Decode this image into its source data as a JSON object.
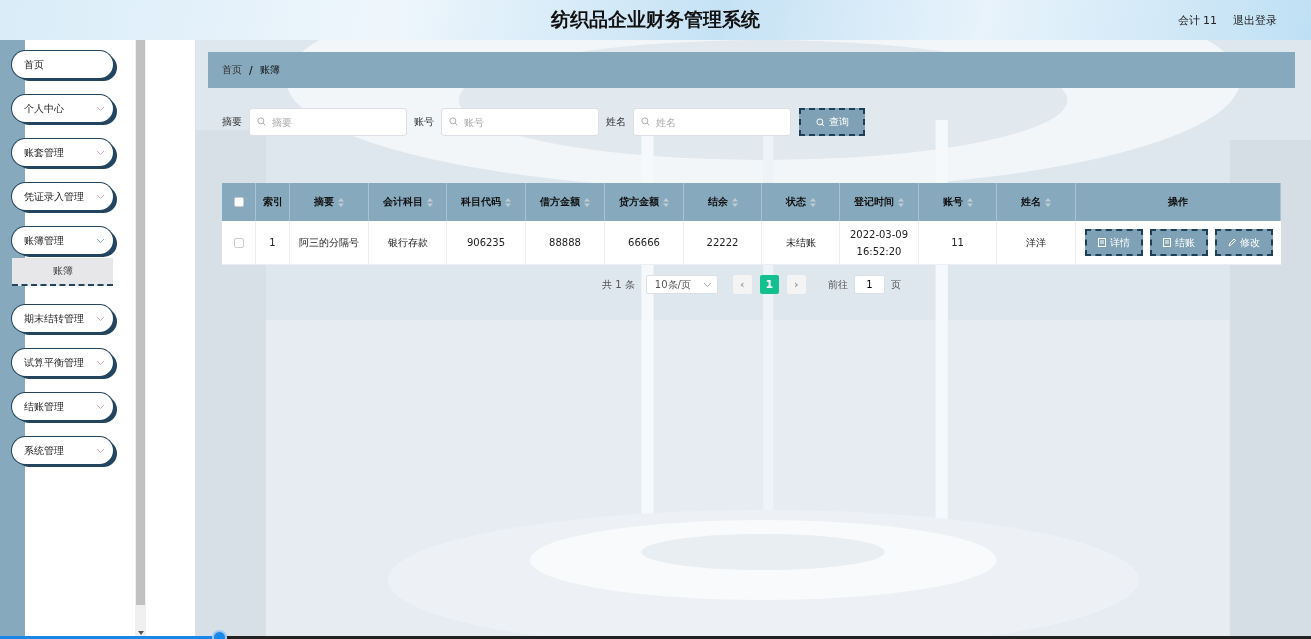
{
  "header": {
    "title": "纺织品企业财务管理系统",
    "user": "会计 11",
    "logout": "退出登录"
  },
  "sidebar": {
    "items": [
      {
        "label": "首页",
        "kind": "link"
      },
      {
        "label": "个人中心",
        "kind": "submenu",
        "expanded": false
      },
      {
        "label": "账套管理",
        "kind": "submenu",
        "expanded": false
      },
      {
        "label": "凭证录入管理",
        "kind": "submenu",
        "expanded": false
      },
      {
        "label": "账簿管理",
        "kind": "submenu",
        "expanded": true,
        "children": [
          {
            "label": "账簿",
            "selected": true
          }
        ]
      },
      {
        "label": "期末结转管理",
        "kind": "submenu",
        "expanded": false
      },
      {
        "label": "试算平衡管理",
        "kind": "submenu",
        "expanded": false
      },
      {
        "label": "结账管理",
        "kind": "submenu",
        "expanded": false
      },
      {
        "label": "系统管理",
        "kind": "submenu",
        "expanded": false
      }
    ]
  },
  "breadcrumb": [
    "首页",
    "账簿"
  ],
  "breadcrumb_separator": "/",
  "search": {
    "fields": [
      {
        "label": "摘要",
        "placeholder": "摘要"
      },
      {
        "label": "账号",
        "placeholder": "账号"
      },
      {
        "label": "姓名",
        "placeholder": "姓名"
      }
    ],
    "button": "查询"
  },
  "table": {
    "select_all": {
      "checked": false
    },
    "columns": [
      {
        "label": "索引",
        "sortable": false
      },
      {
        "label": "摘要",
        "sortable": true
      },
      {
        "label": "会计科目",
        "sortable": true
      },
      {
        "label": "科目代码",
        "sortable": true
      },
      {
        "label": "借方金额",
        "sortable": true
      },
      {
        "label": "贷方金额",
        "sortable": true
      },
      {
        "label": "结余",
        "sortable": true
      },
      {
        "label": "状态",
        "sortable": true
      },
      {
        "label": "登记时间",
        "sortable": true
      },
      {
        "label": "账号",
        "sortable": true
      },
      {
        "label": "姓名",
        "sortable": true
      },
      {
        "label": "操作",
        "sortable": false
      }
    ],
    "rows": [
      {
        "checked": false,
        "cells": [
          "1",
          "阿三的分隔号",
          "银行存款",
          "906235",
          "88888",
          "66666",
          "22222",
          "未结账",
          "2022-03-09 16:52:20",
          "11",
          "洋洋"
        ],
        "actions": [
          {
            "label": "详情",
            "kind": "doc"
          },
          {
            "label": "结账",
            "kind": "doc"
          },
          {
            "label": "修改",
            "kind": "edit"
          }
        ]
      }
    ]
  },
  "pagination": {
    "total": "共 1 条",
    "page_size": "10条/页",
    "prev": "‹",
    "next": "›",
    "pages": [
      {
        "label": "1",
        "selected": true
      }
    ],
    "goto_label": "前往",
    "goto_value": "1",
    "goto_suffix": "页"
  },
  "playback_bar": {
    "level": 0.167
  }
}
